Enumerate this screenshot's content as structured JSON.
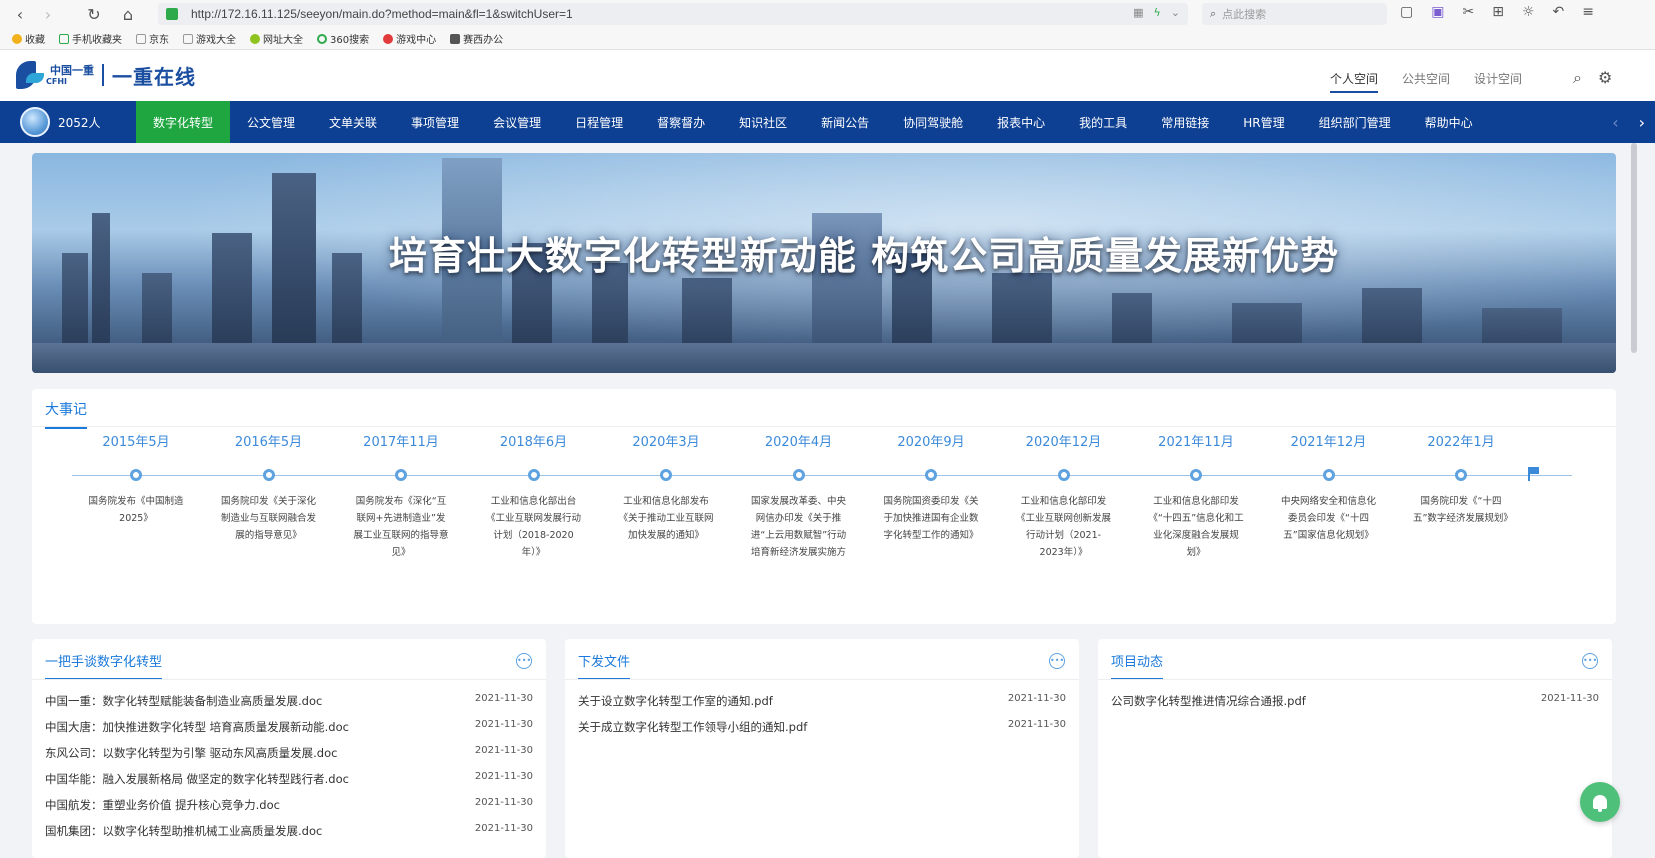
{
  "browser": {
    "url": "http://172.16.11.125/seeyon/main.do?method=main&fl=1&switchUser=1",
    "search_placeholder": "点此搜索"
  },
  "bookmarks": [
    "收藏",
    "手机收藏夹",
    "京东",
    "游戏大全",
    "网址大全",
    "360搜索",
    "游戏中心",
    "赛西办公"
  ],
  "header": {
    "logo_cn": "中国一重",
    "logo_en": "CFHI",
    "site_title": "一重在线",
    "space_tabs": [
      "个人空间",
      "公共空间",
      "设计空间"
    ]
  },
  "nav": {
    "user_count": "2052人",
    "items": [
      "数字化转型",
      "公文管理",
      "文单关联",
      "事项管理",
      "会议管理",
      "日程管理",
      "督察督办",
      "知识社区",
      "新闻公告",
      "协同驾驶舱",
      "报表中心",
      "我的工具",
      "常用链接",
      "HR管理",
      "组织部门管理",
      "帮助中心"
    ],
    "active_index": 0
  },
  "banner": {
    "title": "培育壮大数字化转型新动能 构筑公司高质量发展新优势"
  },
  "events": {
    "title": "大事记",
    "items": [
      {
        "date": "2015年5月",
        "desc": "国务院发布《中国制造2025》"
      },
      {
        "date": "2016年5月",
        "desc": "国务院印发《关于深化制造业与互联网融合发展的指导意见》"
      },
      {
        "date": "2017年11月",
        "desc": "国务院发布《深化“互联网+先进制造业”发展工业互联网的指导意见》"
      },
      {
        "date": "2018年6月",
        "desc": "工业和信息化部出台《工业互联网发展行动计划（2018-2020年）》"
      },
      {
        "date": "2020年3月",
        "desc": "工业和信息化部发布《关于推动工业互联网加快发展的通知》"
      },
      {
        "date": "2020年4月",
        "desc": "国家发展改革委、中央网信办印发《关于推进“上云用数赋智”行动 培育新经济发展实施方"
      },
      {
        "date": "2020年9月",
        "desc": "国务院国资委印发《关于加快推进国有企业数字化转型工作的通知》"
      },
      {
        "date": "2020年12月",
        "desc": "工业和信息化部印发《工业互联网创新发展行动计划（2021-2023年）》"
      },
      {
        "date": "2021年11月",
        "desc": "工业和信息化部印发《“十四五”信息化和工业化深度融合发展规划》"
      },
      {
        "date": "2021年12月",
        "desc": "中央网络安全和信息化委员会印发《“十四五”国家信息化规划》"
      },
      {
        "date": "2022年1月",
        "desc": "国务院印发《“十四五”数字经济发展规划》"
      }
    ]
  },
  "lists": [
    {
      "title": "一把手谈数字化转型",
      "rows": [
        {
          "text": "中国一重：数字化转型赋能装备制造业高质量发展.doc",
          "date": "2021-11-30"
        },
        {
          "text": "中国大唐：加快推进数字化转型 培育高质量发展新动能.doc",
          "date": "2021-11-30"
        },
        {
          "text": "东风公司：以数字化转型为引擎 驱动东风高质量发展.doc",
          "date": "2021-11-30"
        },
        {
          "text": "中国华能：融入发展新格局 做坚定的数字化转型践行者.doc",
          "date": "2021-11-30"
        },
        {
          "text": "中国航发：重塑业务价值 提升核心竞争力.doc",
          "date": "2021-11-30"
        },
        {
          "text": "国机集团：以数字化转型助推机械工业高质量发展.doc",
          "date": "2021-11-30"
        }
      ]
    },
    {
      "title": "下发文件",
      "rows": [
        {
          "text": "关于设立数字化转型工作室的通知.pdf",
          "date": "2021-11-30"
        },
        {
          "text": "关于成立数字化转型工作领导小组的通知.pdf",
          "date": "2021-11-30"
        }
      ]
    },
    {
      "title": "项目动态",
      "rows": [
        {
          "text": "公司数字化转型推进情况综合通报.pdf",
          "date": "2021-11-30"
        }
      ]
    }
  ],
  "colors": {
    "nav_bg": "#0d3f93",
    "nav_active": "#1fa640",
    "accent": "#1a79d9",
    "fab": "#4ec07a"
  }
}
